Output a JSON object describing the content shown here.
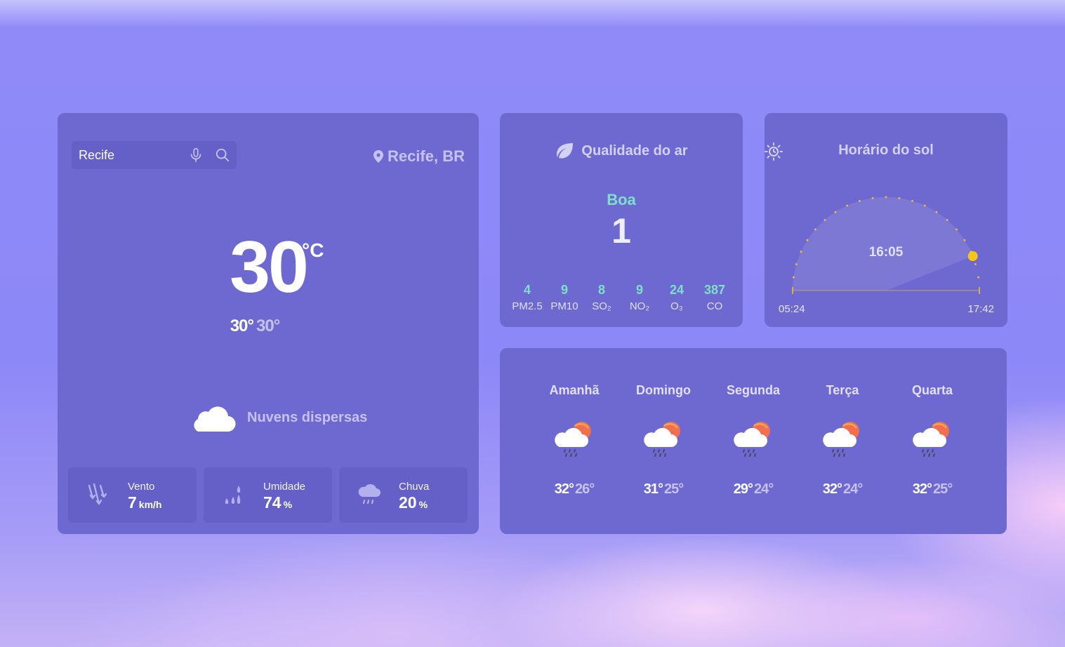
{
  "search": {
    "value": "Recife",
    "placeholder": ""
  },
  "location": {
    "label": "Recife, BR"
  },
  "current": {
    "temp": "30",
    "unit": "°C",
    "max": "30°",
    "min": "30°",
    "condition": "Nuvens dispersas"
  },
  "stats": [
    {
      "label": "Vento",
      "value": "7",
      "unit": "km/h"
    },
    {
      "label": "Umidade",
      "value": "74",
      "unit": "%"
    },
    {
      "label": "Chuva",
      "value": "20",
      "unit": "%"
    }
  ],
  "air": {
    "title": "Qualidade do ar",
    "status": "Boa",
    "index": "1",
    "pollutants": [
      {
        "name": "PM2.5",
        "value": "4"
      },
      {
        "name": "PM10",
        "value": "9"
      },
      {
        "name": "SO₂",
        "value": "8"
      },
      {
        "name": "NO₂",
        "value": "9"
      },
      {
        "name": "O₃",
        "value": "24"
      },
      {
        "name": "CO",
        "value": "387"
      }
    ]
  },
  "sun": {
    "title": "Horário do sol",
    "now": "16:05",
    "sunrise": "05:24",
    "sunset": "17:42",
    "progress": 0.88
  },
  "forecast": [
    {
      "day": "Amanhã",
      "max": "32°",
      "min": "26°",
      "icon": "rain-sun-cloud-icon"
    },
    {
      "day": "Domingo",
      "max": "31°",
      "min": "25°",
      "icon": "rain-sun-cloud-icon"
    },
    {
      "day": "Segunda",
      "max": "29°",
      "min": "24°",
      "icon": "rain-sun-cloud-icon"
    },
    {
      "day": "Terça",
      "max": "32°",
      "min": "24°",
      "icon": "rain-sun-cloud-icon"
    },
    {
      "day": "Quarta",
      "max": "32°",
      "min": "25°",
      "icon": "rain-sun-cloud-icon"
    }
  ],
  "colors": {
    "card": "#6e69d0",
    "accent_green": "#7de0c8",
    "sun_yellow": "#f5c518"
  }
}
